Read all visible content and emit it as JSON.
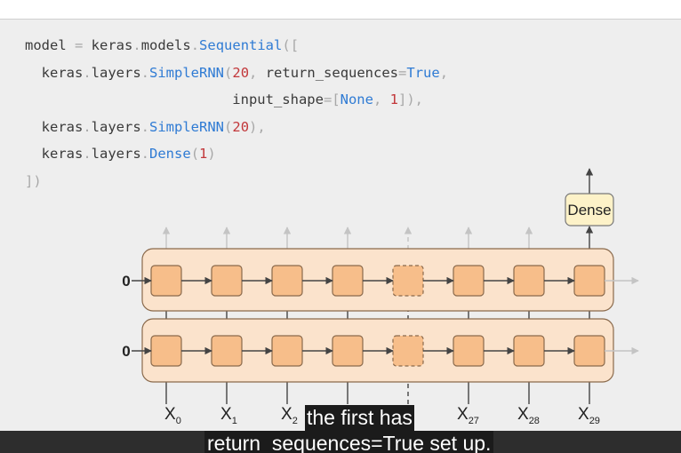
{
  "code": {
    "line1": {
      "t1": "model",
      "t2": " = ",
      "t3": "keras",
      "t4": ".",
      "t5": "models",
      "t6": ".",
      "t7": "Sequential",
      "t8": "(["
    },
    "line2": {
      "t1": "  keras",
      "t2": ".",
      "t3": "layers",
      "t4": ".",
      "t5": "SimpleRNN",
      "t6": "(",
      "t7": "20",
      "t8": ", ",
      "t9": "return_sequences",
      "t10": "=",
      "t11": "True",
      "t12": ","
    },
    "line3": {
      "t1": "                         input_shape",
      "t2": "=",
      "t3": "[",
      "t4": "None",
      "t5": ", ",
      "t6": "1",
      "t7": "]),"
    },
    "line4": {
      "t1": "  keras",
      "t2": ".",
      "t3": "layers",
      "t4": ".",
      "t5": "SimpleRNN",
      "t6": "(",
      "t7": "20",
      "t8": "),"
    },
    "line5": {
      "t1": "  keras",
      "t2": ".",
      "t3": "layers",
      "t4": ".",
      "t5": "Dense",
      "t6": "(",
      "t7": "1",
      "t8": ")"
    },
    "line6": {
      "t1": "])"
    }
  },
  "diagram": {
    "dense_label": "Dense",
    "initial_state_top": "0",
    "initial_state_bottom": "0",
    "inputs": [
      {
        "base": "X",
        "sub": "0"
      },
      {
        "base": "X",
        "sub": "1"
      },
      {
        "base": "X",
        "sub": "2"
      },
      {
        "base": "X",
        "sub": "27"
      },
      {
        "base": "X",
        "sub": "28"
      },
      {
        "base": "X",
        "sub": "29"
      }
    ]
  },
  "subtitles": {
    "line1": "the first has",
    "line2": "return_sequences=True set up."
  },
  "colors": {
    "slide_bg": "#eeeeee",
    "layer_band": "#fbe3cc",
    "cell_fill": "#f7be8a",
    "cell_stroke": "#8a6a4c",
    "dense_fill": "#fdf2c8",
    "code_function": "#2f7bd4",
    "code_number": "#c2373a"
  }
}
